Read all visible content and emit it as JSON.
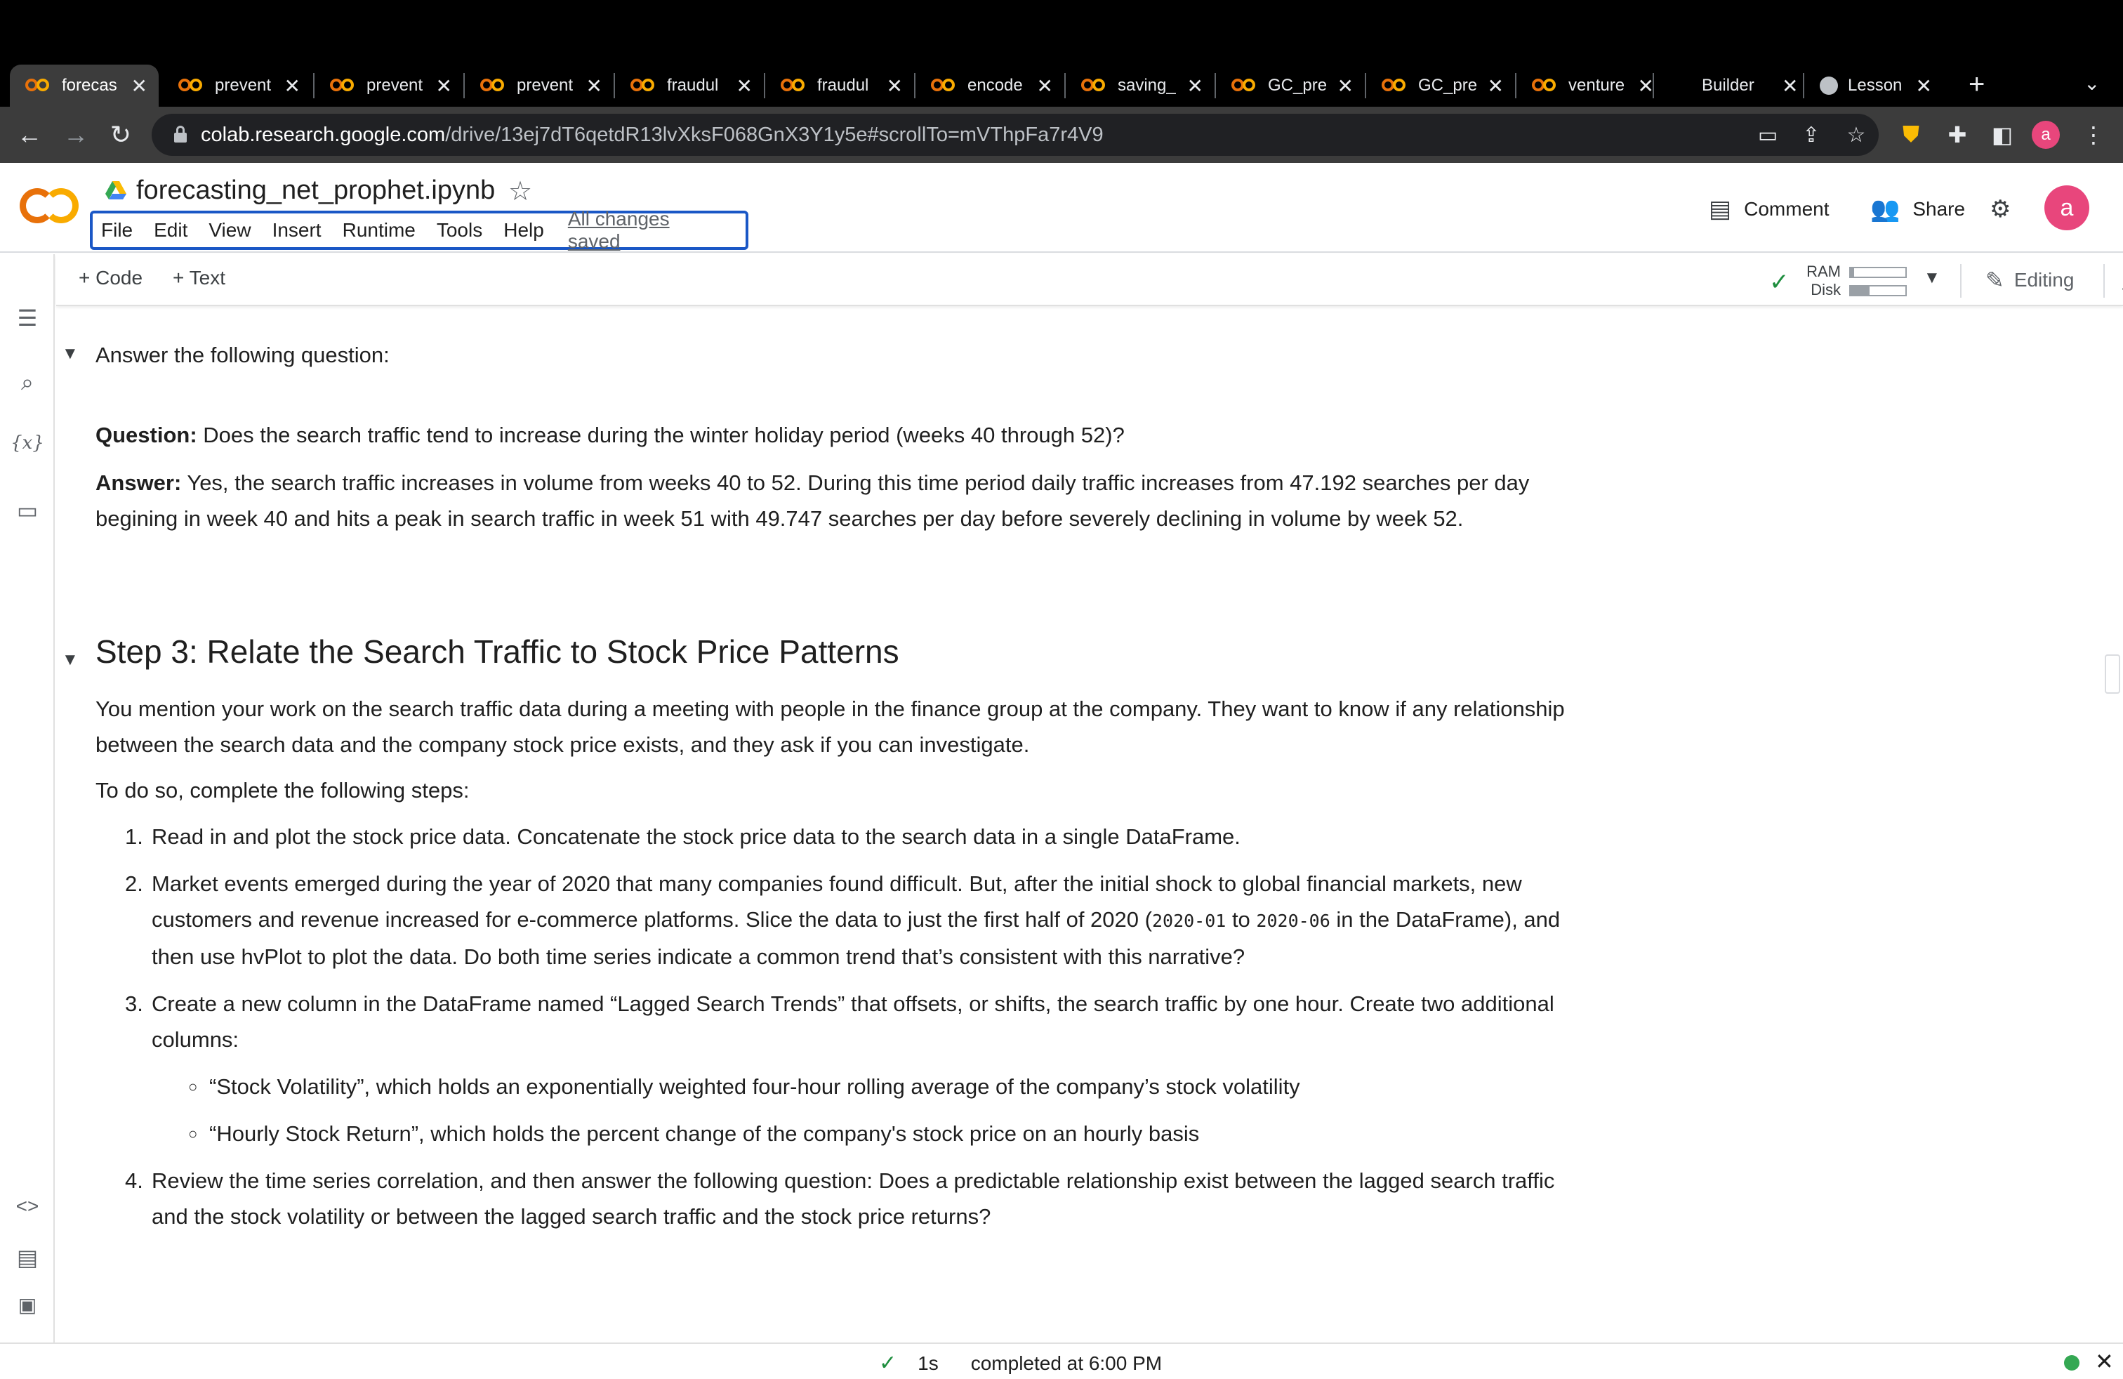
{
  "browser": {
    "tabs": [
      {
        "title": "forecas",
        "icon": "colab"
      },
      {
        "title": "prevent",
        "icon": "colab"
      },
      {
        "title": "prevent",
        "icon": "colab"
      },
      {
        "title": "prevent",
        "icon": "colab"
      },
      {
        "title": "fraudul",
        "icon": "colab"
      },
      {
        "title": "fraudul",
        "icon": "colab"
      },
      {
        "title": "encode",
        "icon": "colab"
      },
      {
        "title": "saving_",
        "icon": "colab"
      },
      {
        "title": "GC_pre",
        "icon": "colab"
      },
      {
        "title": "GC_pre",
        "icon": "colab"
      },
      {
        "title": "venture",
        "icon": "colab"
      },
      {
        "title": "Builder",
        "icon": "none"
      },
      {
        "title": "Lesson",
        "icon": "github"
      }
    ],
    "url_host": "colab.research.google.com",
    "url_path": "/drive/13ej7dT6qetdR13lvXksF068GnX3Y1y5e#scrollTo=mVThpFa7r4V9",
    "profile_initial": "a"
  },
  "colab": {
    "notebook_title": "forecasting_net_prophet.ipynb",
    "menu": [
      "File",
      "Edit",
      "View",
      "Insert",
      "Runtime",
      "Tools",
      "Help"
    ],
    "save_status": "All changes saved",
    "comment_label": "Comment",
    "share_label": "Share",
    "avatar_initial": "a",
    "add_code_label": "+ Code",
    "add_text_label": "+ Text",
    "ram_label": "RAM",
    "disk_label": "Disk",
    "ram_usage": 0.06,
    "disk_usage": 0.35,
    "editing_label": "Editing"
  },
  "cells": {
    "answer_heading": "Answer the following question:",
    "question_label": "Question:",
    "question_text": " Does the search traffic tend to increase during the winter holiday period (weeks 40 through 52)?",
    "answer_label": "Answer:",
    "answer_text": " Yes, the search traffic increases in volume from weeks 40 to 52. During this time period daily traffic increases from 47.192 searches per day begining in week 40 and hits a peak in search traffic in week 51 with 49.747 searches per day before severely declining in volume by week 52.",
    "step3_heading": "Step 3: Relate the Search Traffic to Stock Price Patterns",
    "step3_intro": "You mention your work on the search traffic data during a meeting with people in the finance group at the company. They want to know if any relationship between the search data and the company stock price exists, and they ask if you can investigate.",
    "step3_todo": "To do so, complete the following steps:",
    "step1": "Read in and plot the stock price data. Concatenate the stock price data to the search data in a single DataFrame.",
    "step2_a": "Market events emerged during the year of 2020 that many companies found difficult. But, after the initial shock to global financial markets, new customers and revenue increased for e-commerce platforms. Slice the data to just the first half of 2020 (",
    "step2_code1": "2020-01",
    "step2_b": " to ",
    "step2_code2": "2020-06",
    "step2_c": " in the DataFrame), and then use hvPlot to plot the data. Do both time series indicate a common trend that’s consistent with this narrative?",
    "step3": "Create a new column in the DataFrame named “Lagged Search Trends” that offsets, or shifts, the search traffic by one hour. Create two additional columns:",
    "sub1": "“Stock Volatility”, which holds an exponentially weighted four-hour rolling average of the company’s stock volatility",
    "sub2": "“Hourly Stock Return”, which holds the percent change of the company's stock price on an hourly basis",
    "step4": "Review the time series correlation, and then answer the following question: Does a predictable relationship exist between the lagged search traffic and the stock volatility or between the lagged search traffic and the stock price returns?"
  },
  "status": {
    "duration": "1s",
    "completed": "completed at 6:00 PM"
  }
}
